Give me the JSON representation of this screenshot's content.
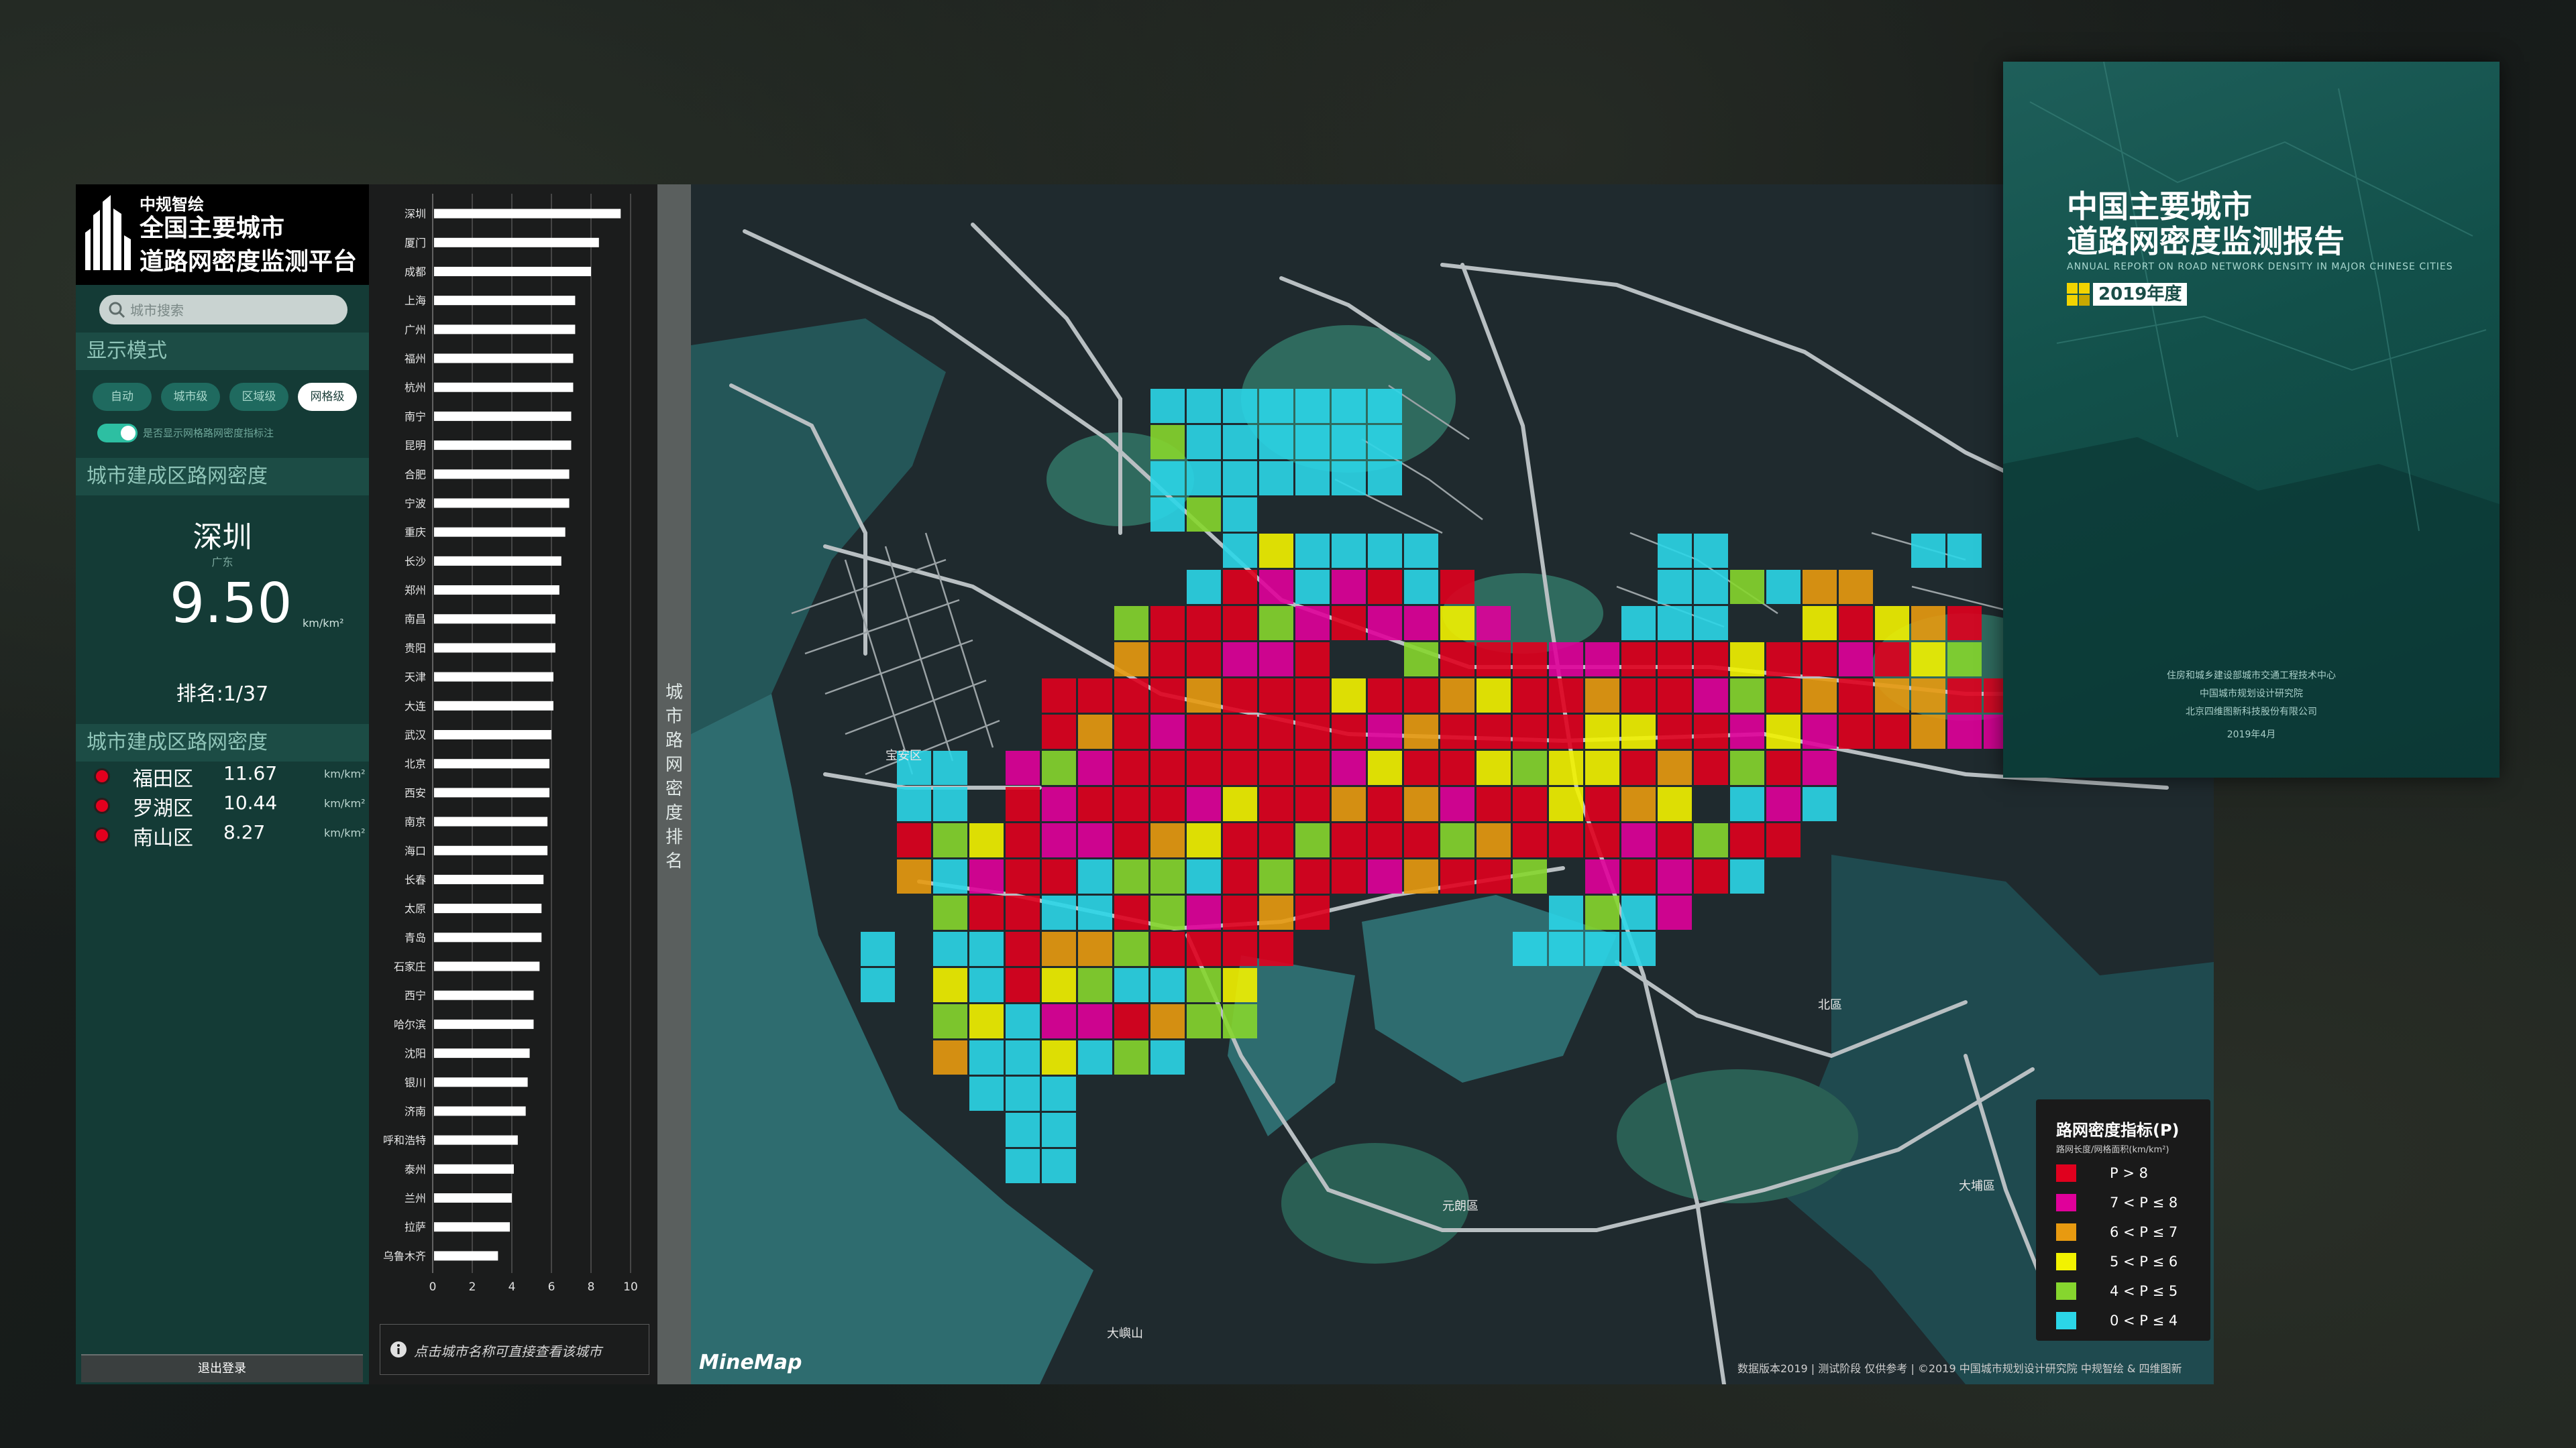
{
  "brand": {
    "small": "中规智绘",
    "line1": "全国主要城市",
    "line2": "道路网密度监测平台"
  },
  "search": {
    "placeholder": "城市搜索"
  },
  "display_mode": {
    "heading": "显示模式",
    "buttons": [
      "自动",
      "城市级",
      "区域级",
      "网格级"
    ],
    "active": "网格级",
    "toggle_label": "是否显示网格路网密度指标注"
  },
  "city_density": {
    "heading": "城市建成区路网密度",
    "city": "深圳",
    "province": "广东",
    "value": "9.50",
    "unit": "km/km²",
    "rank": "排名:1/37"
  },
  "district_density": {
    "heading": "城市建成区路网密度",
    "items": [
      {
        "name": "福田区",
        "value": "11.67",
        "unit": "km/km²"
      },
      {
        "name": "罗湖区",
        "value": "10.44",
        "unit": "km/km²"
      },
      {
        "name": "南山区",
        "value": "8.27",
        "unit": "km/km²"
      }
    ]
  },
  "logout": "退出登录",
  "ranking": {
    "tab_label": "城市路网密度排名",
    "tip": "点击城市名称可直接查看该城市",
    "chart_data": {
      "type": "bar",
      "orientation": "horizontal",
      "categories": [
        "深圳",
        "厦门",
        "成都",
        "上海",
        "广州",
        "福州",
        "杭州",
        "南宁",
        "昆明",
        "合肥",
        "宁波",
        "重庆",
        "长沙",
        "郑州",
        "南昌",
        "贵阳",
        "天津",
        "大连",
        "武汉",
        "北京",
        "西安",
        "南京",
        "海口",
        "长春",
        "太原",
        "青岛",
        "石家庄",
        "西宁",
        "哈尔滨",
        "沈阳",
        "银川",
        "济南",
        "呼和浩特",
        "泰州",
        "兰州",
        "拉萨",
        "乌鲁木齐"
      ],
      "values": [
        9.5,
        8.4,
        8.0,
        7.2,
        7.2,
        7.1,
        7.1,
        7.0,
        7.0,
        6.9,
        6.9,
        6.7,
        6.5,
        6.4,
        6.2,
        6.2,
        6.1,
        6.1,
        6.0,
        5.9,
        5.9,
        5.8,
        5.8,
        5.6,
        5.5,
        5.5,
        5.4,
        5.1,
        5.1,
        4.9,
        4.8,
        4.7,
        4.3,
        4.1,
        4.0,
        3.9,
        3.3
      ],
      "xlim": [
        0,
        10
      ],
      "ticks": [
        0,
        2,
        4,
        6,
        8,
        10
      ]
    }
  },
  "map": {
    "district_labels": [
      "宝安区",
      "元朗區",
      "大埔區",
      "大嶼山",
      "北區"
    ],
    "logo": "MineMap",
    "attribution": "数据版本2019 | 测试阶段 仅供参考 | ©2019 中国城市规划设计研究院 中规智绘 & 四维图新",
    "colors": {
      "p_gt_8": "#e0001e",
      "p_7_8": "#e0009a",
      "p_6_7": "#e89a10",
      "p_5_6": "#f2f200",
      "p_4_5": "#86d62e",
      "p_0_4": "#2bd6e8"
    }
  },
  "legend": {
    "title": "路网密度指标(P)",
    "subtitle": "路网长度/网格面积(km/km²)",
    "items": [
      {
        "label": "P > 8",
        "color": "#e0001e"
      },
      {
        "label": "7 < P ≤ 8",
        "color": "#e0009a"
      },
      {
        "label": "6 < P ≤ 7",
        "color": "#e89a10"
      },
      {
        "label": "5 < P ≤ 6",
        "color": "#f2f200"
      },
      {
        "label": "4 < P ≤ 5",
        "color": "#86d62e"
      },
      {
        "label": "0 < P ≤ 4",
        "color": "#2bd6e8"
      }
    ]
  },
  "report": {
    "title1": "中国主要城市",
    "title2": "道路网密度监测报告",
    "en": "ANNUAL REPORT ON ROAD NETWORK DENSITY IN MAJOR CHINESE CITIES",
    "year": "2019年度",
    "orgs": [
      "住房和城乡建设部城市交通工程技术中心",
      "中国城市规划设计研究院",
      "北京四维图新科技股份有限公司"
    ],
    "date": "2019年4月"
  }
}
